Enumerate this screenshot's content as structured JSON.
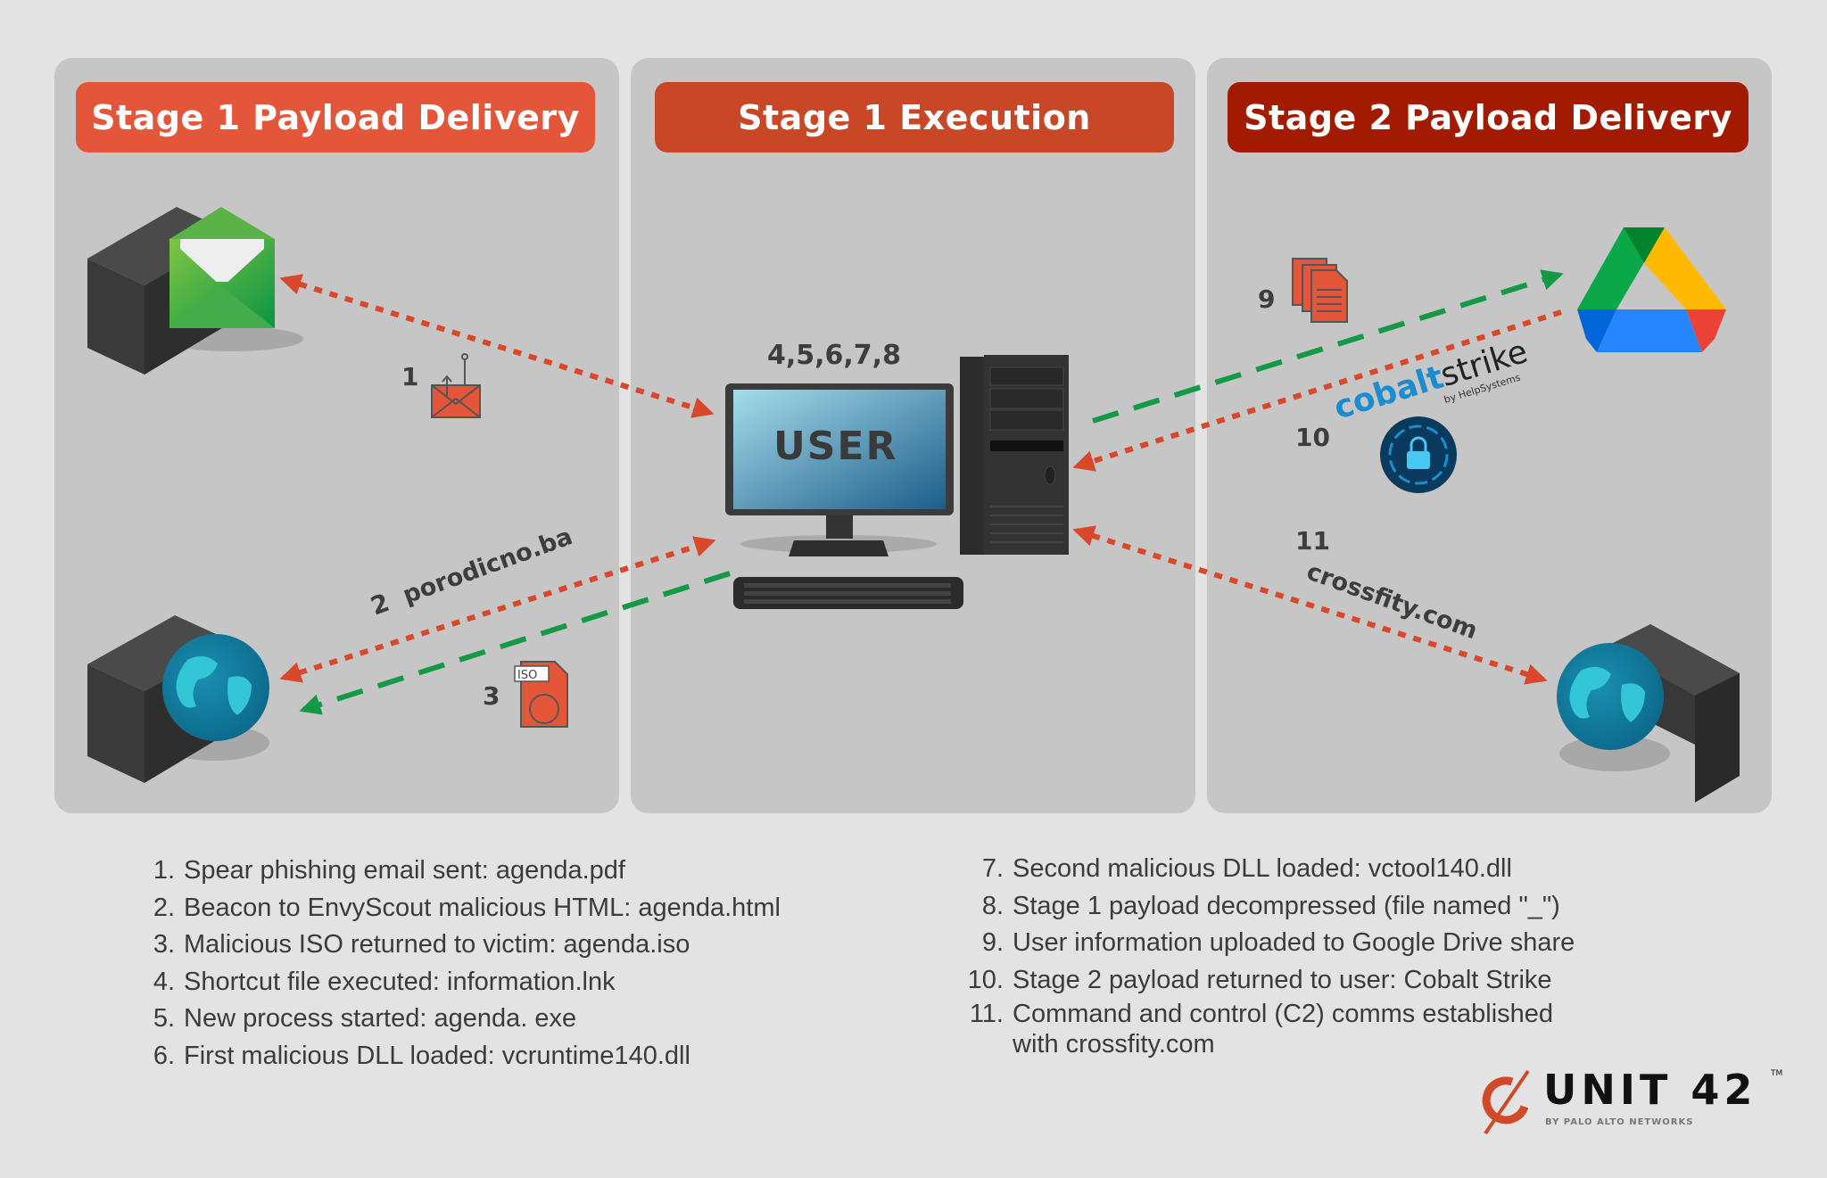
{
  "stages": [
    {
      "title": "Stage 1 Payload Delivery",
      "color": "#e4563a"
    },
    {
      "title": "Stage 1 Execution",
      "color": "#c84727"
    },
    {
      "title": "Stage 2 Payload Delivery",
      "color": "#a21b00"
    }
  ],
  "diagram": {
    "user_label": "USER",
    "user_steps": "4,5,6,7,8",
    "step1": "1",
    "step2": "2",
    "step2_domain": "porodicno.ba",
    "step3": "3",
    "iso_label": "ISO",
    "step9": "9",
    "step10": "10",
    "cobalt_brand_a": "cobalt",
    "cobalt_brand_b": "strike",
    "cobalt_byline": "by HelpSystems",
    "step11": "11",
    "step11_domain": "crossfity.com"
  },
  "colors": {
    "red_arrow": "#d9482a",
    "green_arrow": "#169947",
    "panel": "#c6c6c6",
    "background": "#e3e3e3"
  },
  "legend_left": [
    {
      "n": "1.",
      "text": "Spear phishing email sent: agenda.pdf"
    },
    {
      "n": "2.",
      "text": "Beacon to EnvyScout malicious HTML: agenda.html"
    },
    {
      "n": "3.",
      "text": "Malicious ISO returned to victim: agenda.iso"
    },
    {
      "n": "4.",
      "text": "Shortcut file executed: information.lnk"
    },
    {
      "n": "5.",
      "text": "New process started: agenda. exe"
    },
    {
      "n": "6.",
      "text": "First malicious DLL loaded: vcruntime140.dll"
    }
  ],
  "legend_right": [
    {
      "n": "7.",
      "text": "Second malicious DLL loaded: vctool140.dll"
    },
    {
      "n": "8.",
      "text": "Stage 1 payload decompressed (file named \"_\")"
    },
    {
      "n": "9.",
      "text": "User information uploaded to Google Drive share"
    },
    {
      "n": "10.",
      "text": "Stage 2 payload returned to user: Cobalt Strike"
    },
    {
      "n": "11.",
      "text": "Command and control (C2) comms established"
    },
    {
      "n": "",
      "text": "with crossfity.com"
    }
  ],
  "logo": {
    "word": "UNIT 42",
    "tm": "TM",
    "sub": "BY PALO ALTO NETWORKS"
  }
}
